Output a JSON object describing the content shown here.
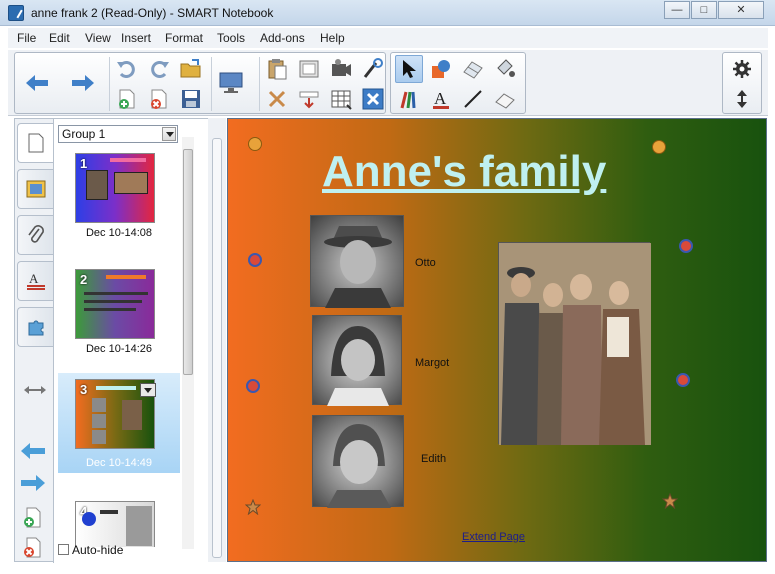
{
  "window": {
    "title": "anne frank 2 (Read-Only) - SMART Notebook",
    "minimize": "—",
    "maximize": "□",
    "close": "✕"
  },
  "menu": [
    "File",
    "Edit",
    "View",
    "Insert",
    "Format",
    "Tools",
    "Add-ons",
    "Help"
  ],
  "toolbar": {
    "icons": [
      "arrow-left-icon",
      "arrow-right-icon",
      "undo-icon",
      "redo-icon",
      "open-file-icon",
      "add-page-icon",
      "delete-page-icon",
      "save-icon",
      "display-icon",
      "paste-icon",
      "screen-shade-icon",
      "clear-page-icon",
      "delete-icon",
      "table-icon",
      "pointer-select-icon",
      "pens-icon",
      "shapes-icon",
      "eraser-icon",
      "lines-icon",
      "text-icon",
      "fill-icon",
      "magic-pen-icon",
      "settings-icon",
      "move-toolbar-icon"
    ]
  },
  "sidebar": {
    "group": "Group 1",
    "pages": [
      {
        "number": "1",
        "label": "Dec 10-14:08"
      },
      {
        "number": "2",
        "label": "Dec 10-14:26"
      },
      {
        "number": "3",
        "label": "Dec 10-14:49"
      },
      {
        "number": "4",
        "label": ""
      }
    ],
    "autohide": "Auto-hide"
  },
  "page": {
    "title": "Anne's family",
    "captions": [
      "Otto",
      "Margot",
      "Edith"
    ],
    "extend": "Extend Page"
  },
  "colors": {
    "title_text": "#bff0f0",
    "gradient_start": "#f26c20",
    "gradient_end": "#18520e",
    "selection": "#a8d4f5"
  }
}
